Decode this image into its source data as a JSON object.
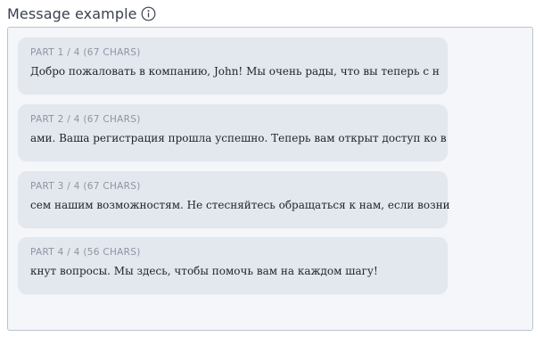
{
  "header": {
    "title": "Message example",
    "info_icon": "info-circle-icon"
  },
  "parts": [
    {
      "label": "PART 1 / 4 (67 CHARS)",
      "text": "Добро пожаловать в компанию, John! Мы очень рады, что вы теперь с н"
    },
    {
      "label": "PART 2 / 4 (67 CHARS)",
      "text": "ами. Ваша регистрация прошла успешно. Теперь вам открыт доступ ко в"
    },
    {
      "label": "PART 3 / 4 (67 CHARS)",
      "text": "сем нашим возможностям. Не стесняйтесь обращаться к нам, если возни"
    },
    {
      "label": "PART 4 / 4 (56 CHARS)",
      "text": "кнут вопросы. Мы здесь, чтобы помочь вам на каждом шагу!"
    }
  ]
}
